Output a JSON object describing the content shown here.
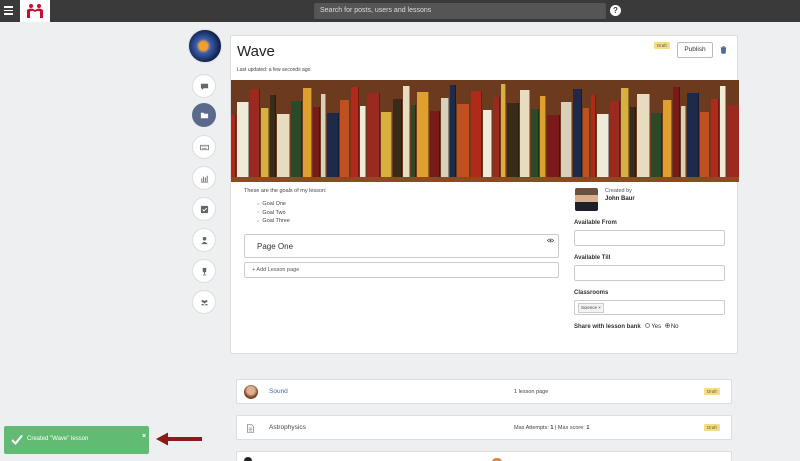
{
  "topbar": {
    "search_placeholder": "Search for posts, users and lessons",
    "help_symbol": "?"
  },
  "colors": {
    "topbar": "#3a3a3a",
    "accent": "#5a6a8a",
    "draft": "#f3dc8a",
    "toast": "#62bb73",
    "arrow": "#8b1a1a",
    "link": "#4a6a9a"
  },
  "sidebar": {
    "icons": [
      "chat-icon",
      "folder-icon",
      "keyboard-icon",
      "bar-chart-icon",
      "checkbox-icon",
      "user-icon",
      "trophy-icon",
      "group-icon"
    ],
    "active_index": 1
  },
  "lesson": {
    "title": "Wave",
    "last_updated": "Last updated: a few seconds ago",
    "status": "Draft",
    "publish_label": "Publish",
    "goals_intro": "These are the goals of my lesson:",
    "goals": [
      "Goal One",
      "Goal Two",
      "Goal Three"
    ],
    "page": {
      "title": "Page One"
    },
    "add_page_label": "+ Add Lesson page",
    "author": {
      "created_by": "Created by",
      "name": "John Baur"
    },
    "available_from_label": "Available From",
    "available_till_label": "Available Till",
    "classrooms_label": "Classrooms",
    "classroom_tag": "Science",
    "tag_remove": "×",
    "share_label": "Share with lesson bank",
    "share_options": [
      "Yes",
      "No"
    ],
    "share_selected": "No"
  },
  "lesson_rows": [
    {
      "name": "Sound",
      "meta": "1 lesson page",
      "status": "Draft"
    },
    {
      "name": "Astrophysics",
      "meta_prefix": "Max Attempts: ",
      "attempts": "1",
      "meta_sep": " | Max score: ",
      "score": "1",
      "status": "Draft"
    }
  ],
  "toast": {
    "message": "Created \"Wave\" lesson",
    "close": "×"
  }
}
